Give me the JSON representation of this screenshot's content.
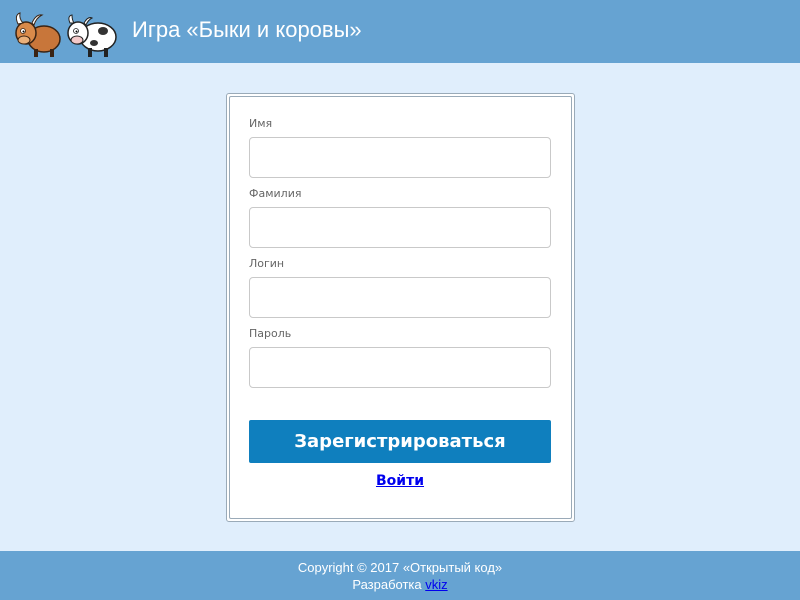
{
  "header": {
    "title": "Игра «Быки и коровы»",
    "logo_icon": "bull-and-cow-logo-icon"
  },
  "form": {
    "fields": [
      {
        "label": "Имя",
        "value": "",
        "placeholder": ""
      },
      {
        "label": "Фамилия",
        "value": "",
        "placeholder": ""
      },
      {
        "label": "Логин",
        "value": "",
        "placeholder": ""
      },
      {
        "label": "Пароль",
        "value": "",
        "placeholder": ""
      }
    ],
    "submit_label": "Зарегистрироваться",
    "login_link": "Войти"
  },
  "footer": {
    "copyright": "Copyright © 2017 «Открытый код»",
    "dev_prefix": "Разработка ",
    "dev_link": "vkiz"
  },
  "colors": {
    "header_bg": "#66a3d2",
    "page_bg": "#e0eefc",
    "button_bg": "#0f7fbe",
    "link": "#0000ee"
  }
}
